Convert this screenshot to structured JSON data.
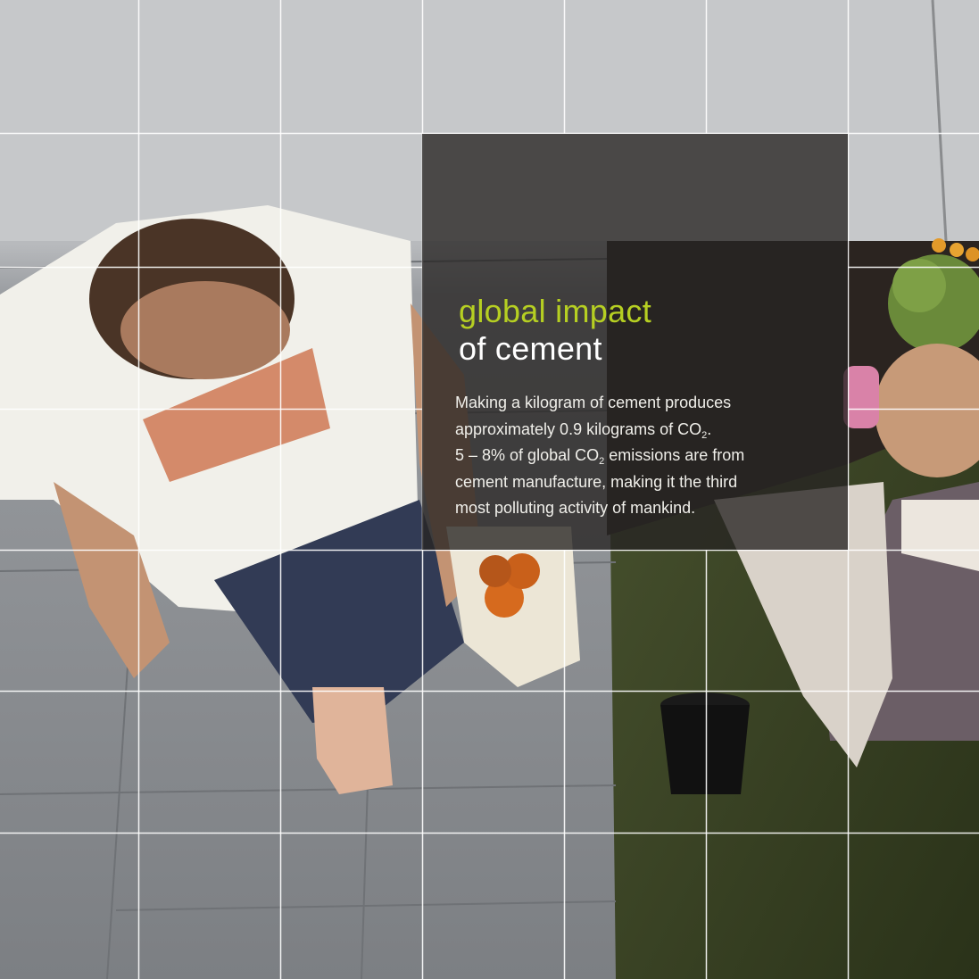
{
  "headline": {
    "accent": "global impact",
    "main": "of cement"
  },
  "body": {
    "line1": "Making a kilogram of cement produces",
    "line2_pre": "approximately 0.9 kilograms of CO",
    "line2_sub": "2",
    "line2_post": ".",
    "line3_pre": "5 – 8% of global CO",
    "line3_sub": "2",
    "line3_post": " emissions are from",
    "line4": "cement manufacture, making it the third",
    "line5": "most polluting activity of mankind."
  },
  "colors": {
    "accent": "#b6cf22",
    "panel": "#262422",
    "grid_lines": "#ffffff",
    "pavement": "#8f9296",
    "grass": "#3a4424"
  }
}
